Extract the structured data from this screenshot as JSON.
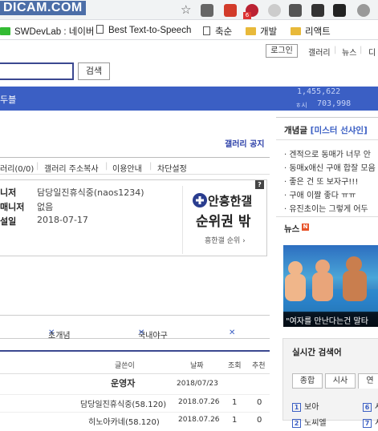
{
  "browser": {
    "url_text": "DICAM.COM",
    "bookmarks": [
      {
        "label": "SWDevLab : 네이버"
      },
      {
        "label": "Best Text-to-Speech"
      },
      {
        "label": "축순"
      },
      {
        "label": "개발"
      },
      {
        "label": "리액트"
      }
    ],
    "extension_badge": "6"
  },
  "top_nav": {
    "login": "로그인",
    "gallery": "갤러리",
    "news": "뉴스",
    "more": "디"
  },
  "search": {
    "value": "",
    "button": "검색"
  },
  "banner": {
    "label": "두블",
    "stat_top": "1,455,622",
    "stat_bottom_prefix": "ㅎ시",
    "stat_bottom": "703,998"
  },
  "gallery": {
    "notice": "갤러리 공지",
    "tabs": [
      "러리(0/0)",
      "갤러리 주소복사",
      "이용안내",
      "차단설정"
    ],
    "info": [
      {
        "label": "니저",
        "value": "담당일진휴식중(naos1234)"
      },
      {
        "label": "매니저",
        "value": "없음"
      },
      {
        "label": "설일",
        "value": "2018-07-17"
      }
    ],
    "ad_line1": "안흥한갤",
    "ad_line2": "순위권 밖",
    "ad_link": "흥한갤 순위 ›",
    "ad_qmark": "?",
    "rank_items": [
      "초개념",
      "국내야구"
    ]
  },
  "board": {
    "headers": {
      "writer": "글쓴이",
      "date": "날짜",
      "views": "조회",
      "recommend": "추천"
    },
    "rows": [
      {
        "writer": "운영자",
        "date": "2018/07/23",
        "views": "",
        "rec": ""
      },
      {
        "writer": "담당일진휴식중(58.120)",
        "date": "2018.07.26",
        "views": "1",
        "rec": "0"
      },
      {
        "writer": "히노아카네(58.120)",
        "date": "2018.07.26",
        "views": "1",
        "rec": "0"
      }
    ]
  },
  "sidebar": {
    "concept_title": "개념글",
    "concept_highlight": "[미스터 선샤인]",
    "concept_items": [
      "겐적으로 동매가 너무 안",
      "동매x애신 구애 합잘 모음",
      "좋은 건 또 보자구!!!",
      "구애 이짤 좋다 ㅠㅠ",
      "유진초이는 그렇게 어두"
    ],
    "news_title": "뉴스",
    "news_badge": "N",
    "news_caption": "\"여자를 만난다는건 말타",
    "realtime_title": "실시간 검색어",
    "realtime_tabs": [
      "종합",
      "시사",
      "연"
    ],
    "realtime_items": [
      {
        "num": "1",
        "label": "보아"
      },
      {
        "num": "2",
        "label": "노씨엘"
      },
      {
        "num": "6",
        "label": "사"
      },
      {
        "num": "7",
        "label": "시"
      }
    ]
  }
}
